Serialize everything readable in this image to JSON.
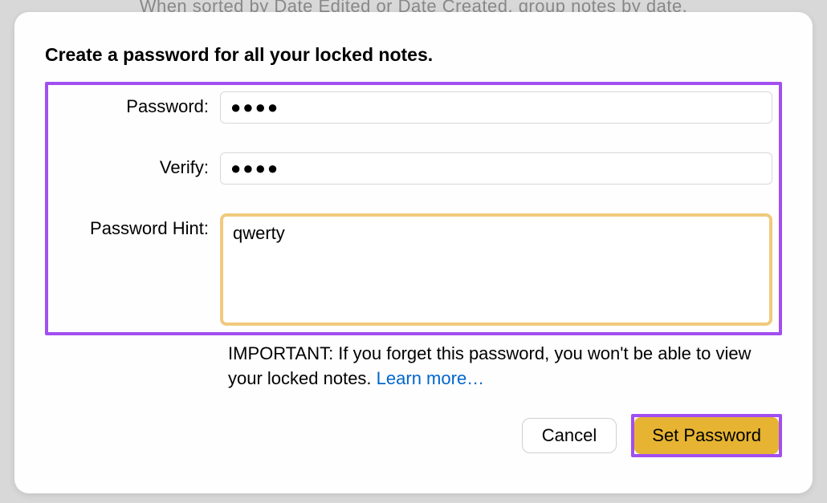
{
  "background_hint": "When sorted by Date Edited or Date Created, group notes by date.",
  "dialog": {
    "title": "Create a password for all your locked notes.",
    "password_label": "Password:",
    "password_value": "●●●●",
    "verify_label": "Verify:",
    "verify_value": "●●●●",
    "hint_label": "Password Hint:",
    "hint_value": "qwerty",
    "important_prefix": "IMPORTANT: If you forget this password, you won't be able to view your locked notes. ",
    "learn_more": "Learn more…",
    "cancel_label": "Cancel",
    "set_password_label": "Set Password"
  }
}
